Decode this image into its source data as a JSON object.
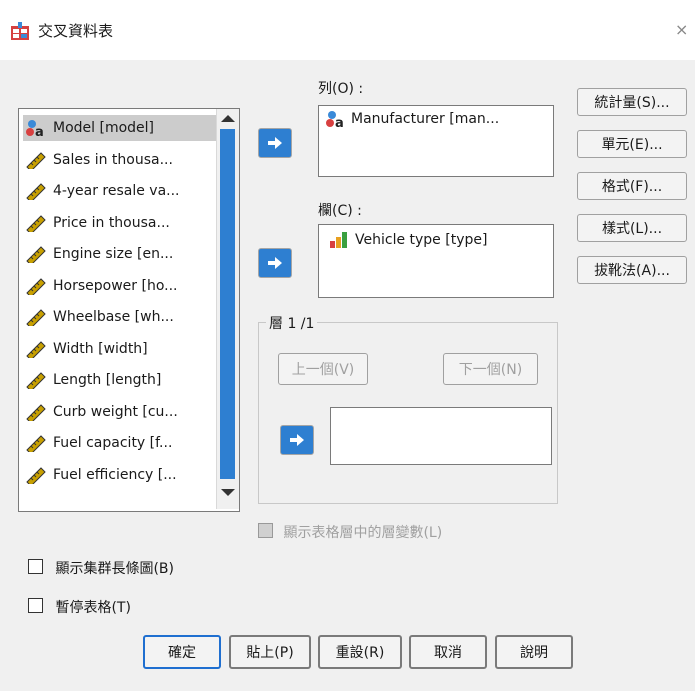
{
  "window": {
    "title": "交叉資料表",
    "close": "×"
  },
  "variables": [
    {
      "label": "Model [model]",
      "icon": "nominal-icon",
      "selected": true
    },
    {
      "label": "Sales in thousa...",
      "icon": "scale-icon"
    },
    {
      "label": "4-year resale va...",
      "icon": "scale-icon"
    },
    {
      "label": "Price in thousa...",
      "icon": "scale-icon"
    },
    {
      "label": "Engine size [en...",
      "icon": "scale-icon"
    },
    {
      "label": "Horsepower [ho...",
      "icon": "scale-icon"
    },
    {
      "label": "Wheelbase [wh...",
      "icon": "scale-icon"
    },
    {
      "label": "Width [width]",
      "icon": "scale-icon"
    },
    {
      "label": "Length [length]",
      "icon": "scale-icon"
    },
    {
      "label": "Curb weight [cu...",
      "icon": "scale-icon"
    },
    {
      "label": "Fuel capacity [f...",
      "icon": "scale-icon"
    },
    {
      "label": "Fuel efficiency [...",
      "icon": "scale-icon"
    }
  ],
  "rows": {
    "label": "列(O) :",
    "items": [
      "Manufacturer [man..."
    ]
  },
  "columns": {
    "label": "欄(C) :",
    "items": [
      "Vehicle type [type]"
    ]
  },
  "layer": {
    "label": "層 1 /1",
    "prev": "上一個(V)",
    "next": "下一個(N)",
    "show_layer_vars": "顯示表格層中的層變數(L)"
  },
  "side_buttons": [
    "統計量(S)...",
    "單元(E)...",
    "格式(F)...",
    "樣式(L)...",
    "拔靴法(A)..."
  ],
  "options": {
    "clustered_bar": "顯示集群長條圖(B)",
    "suppress_tables": "暫停表格(T)"
  },
  "bottom_buttons": {
    "ok": "確定",
    "paste": "貼上(P)",
    "reset": "重設(R)",
    "cancel": "取消",
    "help": "說明"
  },
  "colors": {
    "accent": "#2e7fd1",
    "scale_icon": "#c8a000",
    "nominal_icon": "#c00000"
  }
}
